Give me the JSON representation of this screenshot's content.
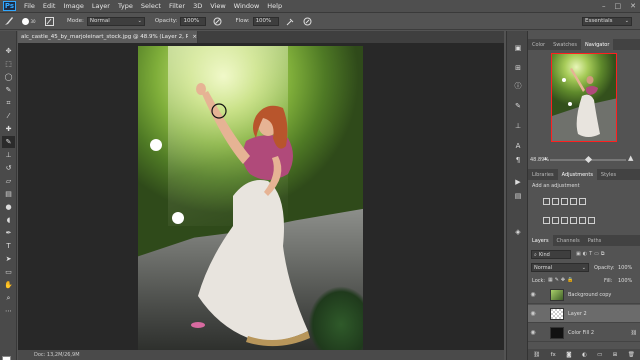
{
  "menu": {
    "app_icon": "Ps",
    "items": [
      "File",
      "Edit",
      "Image",
      "Layer",
      "Type",
      "Select",
      "Filter",
      "3D",
      "View",
      "Window",
      "Help"
    ],
    "window_controls": [
      "–",
      "□",
      "✕"
    ]
  },
  "options": {
    "brush_size": "30",
    "mode_label": "Mode:",
    "mode_value": "Normal",
    "opacity_label": "Opacity:",
    "opacity_value": "100%",
    "flow_label": "Flow:",
    "flow_value": "100%",
    "workspace": "Essentials"
  },
  "document": {
    "tab_title": "alc_castle_45_by_marjoleinart_stock.jpg @ 48.9% (Layer 2, RGB/8) *",
    "status_text": "Doc: 13,2M/26,9M"
  },
  "panels": {
    "top_tabs": [
      "Color",
      "Swatches",
      "Navigator"
    ],
    "top_active": "Navigator",
    "zoom": "48.89%",
    "mid_tabs": [
      "Libraries",
      "Adjustments",
      "Styles"
    ],
    "mid_active": "Adjustments",
    "adjust_hint": "Add an adjustment",
    "layer_tabs": [
      "Layers",
      "Channels",
      "Paths"
    ],
    "layer_active": "Layers",
    "kind_label": "Kind",
    "blend_mode": "Normal",
    "opacity_label": "Opacity:",
    "opacity_value": "100%",
    "lock_label": "Lock:",
    "fill_label": "Fill:",
    "fill_value": "100%",
    "layers": [
      {
        "name": "Background copy",
        "selected": false
      },
      {
        "name": "Layer 2",
        "selected": true
      },
      {
        "name": "Color Fill 2",
        "selected": false
      }
    ],
    "footer_icons": "fx"
  },
  "icons": {
    "move": "move-icon",
    "marquee": "marquee-icon",
    "lasso": "lasso-icon",
    "brush": "brush-icon"
  },
  "colors": {
    "foreground": "#ffffff",
    "background": "#000000",
    "nav_frame": "#ff2020",
    "ps_blue": "#31a8ff"
  }
}
